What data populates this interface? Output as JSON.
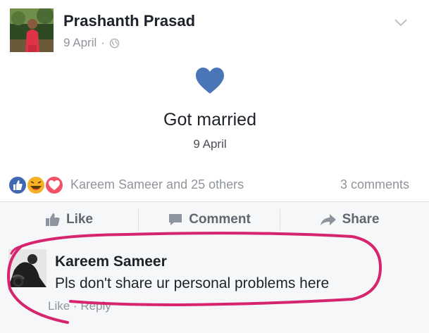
{
  "post": {
    "author": "Prashanth Prasad",
    "date": "9 April",
    "separator": "·",
    "privacy_icon": "globe-icon",
    "menu_icon": "chevron-down-icon"
  },
  "life_event": {
    "icon": "heart-icon",
    "title": "Got married",
    "date": "9 April"
  },
  "reactions": {
    "icons": [
      "like-reaction-icon",
      "haha-reaction-icon",
      "love-reaction-icon"
    ],
    "summary": "Kareem Sameer and 25 others",
    "comments": "3 comments"
  },
  "actions": {
    "like": "Like",
    "comment": "Comment",
    "share": "Share"
  },
  "comment": {
    "author": "Kareem Sameer",
    "text": "Pls don't share ur personal problems here",
    "like": "Like",
    "separator": "·",
    "reply": "Reply"
  },
  "colors": {
    "brand_blue": "#4267b2",
    "love_red": "#f25268",
    "haha_yellow": "#f7b125",
    "annotation_pink": "#d6246e"
  }
}
